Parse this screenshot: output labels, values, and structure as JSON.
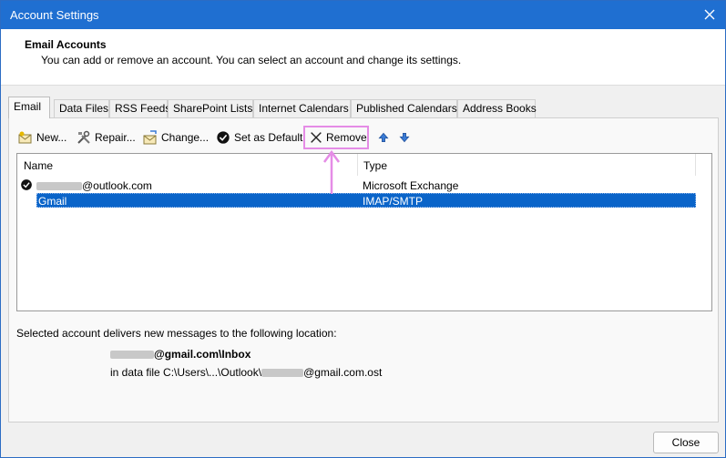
{
  "window": {
    "title": "Account Settings"
  },
  "header": {
    "title": "Email Accounts",
    "subtitle": "You can add or remove an account. You can select an account and change its settings."
  },
  "tabs": [
    {
      "label": "Email",
      "active": true
    },
    {
      "label": "Data Files"
    },
    {
      "label": "RSS Feeds"
    },
    {
      "label": "SharePoint Lists"
    },
    {
      "label": "Internet Calendars"
    },
    {
      "label": "Published Calendars"
    },
    {
      "label": "Address Books"
    }
  ],
  "toolbar": {
    "new_label": "New...",
    "repair_label": "Repair...",
    "change_label": "Change...",
    "default_label": "Set as Default",
    "remove_label": "Remove"
  },
  "list": {
    "col_name": "Name",
    "col_type": "Type",
    "rows": [
      {
        "name": "@outlook.com",
        "type": "Microsoft Exchange",
        "default": true
      },
      {
        "name": "Gmail",
        "type": "IMAP/SMTP",
        "selected": true
      }
    ]
  },
  "location": {
    "label": "Selected account delivers new messages to the following location:",
    "folder": "@gmail.com\\Inbox",
    "datafile_prefix": "in data file C:\\Users\\...\\Outlook\\",
    "datafile_suffix": "@gmail.com.ost"
  },
  "footer": {
    "close_label": "Close"
  },
  "colors": {
    "titlebar": "#1f6fd1",
    "selection": "#0a64c9",
    "highlight": "#e58ce6"
  }
}
